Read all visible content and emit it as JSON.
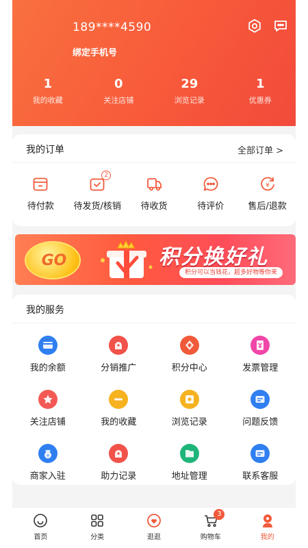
{
  "header": {
    "phone": "189****4590",
    "bind_label": "绑定手机号",
    "stats": [
      {
        "value": "1",
        "label": "我的收藏"
      },
      {
        "value": "0",
        "label": "关注店铺"
      },
      {
        "value": "29",
        "label": "浏览记录"
      },
      {
        "value": "1",
        "label": "优惠券"
      }
    ]
  },
  "orders": {
    "title": "我的订单",
    "all_label": "全部订单 >",
    "items": [
      {
        "label": "待付款",
        "icon": "wallet-icon"
      },
      {
        "label": "待发货/核销",
        "icon": "package-check-icon",
        "badge": "2"
      },
      {
        "label": "待收货",
        "icon": "truck-icon"
      },
      {
        "label": "待评价",
        "icon": "comment-icon"
      },
      {
        "label": "售后/退款",
        "icon": "refund-icon"
      }
    ]
  },
  "banner": {
    "go_text": "GO",
    "title": "积分换好礼",
    "subtitle": "积分可以当钱花，超多好物等你来"
  },
  "services": {
    "title": "我的服务",
    "items": [
      {
        "label": "我的余额",
        "icon": "balance-icon",
        "color": "#2f7ff0"
      },
      {
        "label": "分销推广",
        "icon": "promotion-icon",
        "color": "#f1524a"
      },
      {
        "label": "积分中心",
        "icon": "points-icon",
        "color": "#f05a3a"
      },
      {
        "label": "发票管理",
        "icon": "invoice-icon",
        "color": "#f046a8"
      },
      {
        "label": "关注店铺",
        "icon": "store-follow-icon",
        "color": "#f35a55"
      },
      {
        "label": "我的收藏",
        "icon": "favorite-icon",
        "color": "#f6b21f"
      },
      {
        "label": "浏览记录",
        "icon": "history-icon",
        "color": "#f6b21f"
      },
      {
        "label": "问题反馈",
        "icon": "feedback-icon",
        "color": "#2f7ff0"
      },
      {
        "label": "商家入驻",
        "icon": "merchant-icon",
        "color": "#2f7ff0"
      },
      {
        "label": "助力记录",
        "icon": "assist-icon",
        "color": "#f1524a"
      },
      {
        "label": "地址管理",
        "icon": "address-icon",
        "color": "#1fb47a"
      },
      {
        "label": "联系客服",
        "icon": "customer-service-icon",
        "color": "#2f7ff0"
      }
    ]
  },
  "tabbar": {
    "items": [
      {
        "label": "首页",
        "icon": "home-icon"
      },
      {
        "label": "分类",
        "icon": "category-icon"
      },
      {
        "label": "逛逛",
        "icon": "explore-icon"
      },
      {
        "label": "购物车",
        "icon": "cart-icon",
        "badge": "3"
      },
      {
        "label": "我的",
        "icon": "profile-icon",
        "active": true
      }
    ]
  },
  "colors": {
    "accent": "#f25a3a",
    "header_start": "#f9703f",
    "header_end": "#f24a3b"
  }
}
